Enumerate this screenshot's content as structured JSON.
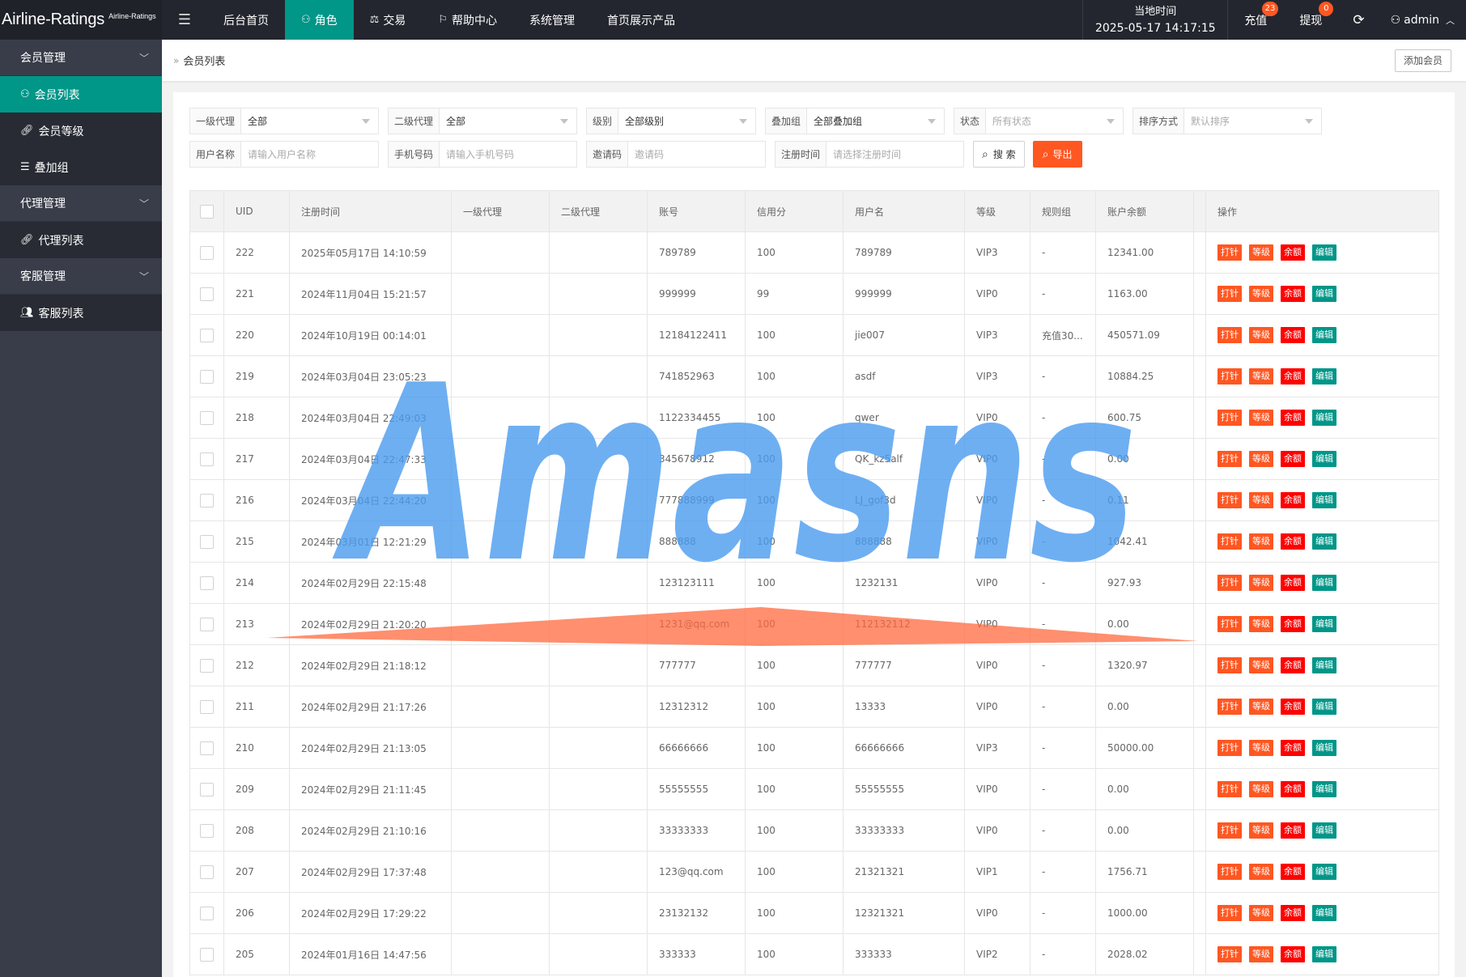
{
  "app": {
    "logo_main": "Airline-Ratings",
    "logo_sub": "Airline-Ratings"
  },
  "nav": [
    {
      "label": "后台首页",
      "icon": ""
    },
    {
      "label": "角色",
      "icon": "user-icon"
    },
    {
      "label": "交易",
      "icon": "scale-icon"
    },
    {
      "label": "帮助中心",
      "icon": "flag-icon"
    },
    {
      "label": "系统管理",
      "icon": ""
    },
    {
      "label": "首页展示产品",
      "icon": ""
    }
  ],
  "topright": {
    "time_label": "当地时间",
    "time_value": "2025-05-17 14:17:15",
    "recharge_label": "充值",
    "recharge_badge": "23",
    "withdraw_label": "提现",
    "withdraw_badge": "0",
    "user_label": "admin"
  },
  "sidebar": [
    {
      "type": "group",
      "label": "会员管理"
    },
    {
      "type": "item",
      "label": "会员列表",
      "icon": "user-icon",
      "active": true
    },
    {
      "type": "item",
      "label": "会员等级",
      "icon": "link-icon"
    },
    {
      "type": "item",
      "label": "叠加组",
      "icon": "list-icon"
    },
    {
      "type": "group",
      "label": "代理管理"
    },
    {
      "type": "item",
      "label": "代理列表",
      "icon": "link-icon"
    },
    {
      "type": "group",
      "label": "客服管理"
    },
    {
      "type": "item",
      "label": "客服列表",
      "icon": "users-icon"
    }
  ],
  "breadcrumb": {
    "current": "会员列表"
  },
  "add_button": "添加会员",
  "filters": {
    "row1": [
      {
        "label": "一级代理",
        "value": "全部",
        "placeholder": false
      },
      {
        "label": "二级代理",
        "value": "全部",
        "placeholder": false
      },
      {
        "label": "级别",
        "value": "全部级别",
        "placeholder": false
      },
      {
        "label": "叠加组",
        "value": "全部叠加组",
        "placeholder": false
      },
      {
        "label": "状态",
        "value": "所有状态",
        "placeholder": true
      },
      {
        "label": "排序方式",
        "value": "默认排序",
        "placeholder": true
      }
    ],
    "row2": [
      {
        "label": "用户名称",
        "value": "请输入用户名称"
      },
      {
        "label": "手机号码",
        "value": "请输入手机号码"
      },
      {
        "label": "邀请码",
        "value": "邀请码"
      },
      {
        "label": "注册时间",
        "value": "请选择注册时间"
      }
    ],
    "search_label": "搜 索",
    "export_label": "导出"
  },
  "table": {
    "headers": [
      "UID",
      "注册时间",
      "一级代理",
      "二级代理",
      "账号",
      "信用分",
      "用户名",
      "等级",
      "规则组",
      "账户余额",
      "",
      "操作"
    ],
    "actions": [
      "打针",
      "等级",
      "余额",
      "编辑"
    ],
    "rows": [
      [
        "222",
        "2025年05月17日 14:10:59",
        "",
        "",
        "789789",
        "100",
        "789789",
        "VIP3",
        "-",
        "12341.00"
      ],
      [
        "221",
        "2024年11月04日 15:21:57",
        "",
        "",
        "999999",
        "99",
        "999999",
        "VIP0",
        "-",
        "1163.00"
      ],
      [
        "220",
        "2024年10月19日 00:14:01",
        "",
        "",
        "12184122411",
        "100",
        "jie007",
        "VIP3",
        "充值30...",
        "450571.09"
      ],
      [
        "219",
        "2024年03月04日 23:05:23",
        "",
        "",
        "741852963",
        "100",
        "asdf",
        "VIP3",
        "-",
        "10884.25"
      ],
      [
        "218",
        "2024年03月04日 22:49:03",
        "",
        "",
        "1122334455",
        "100",
        "qwer",
        "VIP0",
        "-",
        "600.75"
      ],
      [
        "217",
        "2024年03月04日 22:47:33",
        "",
        "",
        "345678912",
        "100",
        "QK_kz5alf",
        "VIP0",
        "-",
        "0.00"
      ],
      [
        "216",
        "2024年03月04日 22:44:20",
        "",
        "",
        "777888999",
        "100",
        "LJ_gof3d",
        "VIP0",
        "-",
        "0.11"
      ],
      [
        "215",
        "2024年03月01日 12:21:29",
        "",
        "",
        "888888",
        "100",
        "888888",
        "VIP0",
        "-",
        "1042.41"
      ],
      [
        "214",
        "2024年02月29日 22:15:48",
        "",
        "",
        "123123111",
        "100",
        "1232131",
        "VIP0",
        "-",
        "927.93"
      ],
      [
        "213",
        "2024年02月29日 21:20:20",
        "",
        "",
        "1231@qq.com",
        "100",
        "112132112",
        "VIP0",
        "-",
        "0.00"
      ],
      [
        "212",
        "2024年02月29日 21:18:12",
        "",
        "",
        "777777",
        "100",
        "777777",
        "VIP0",
        "-",
        "1320.97"
      ],
      [
        "211",
        "2024年02月29日 21:17:26",
        "",
        "",
        "12312312",
        "100",
        "13333",
        "VIP0",
        "-",
        "0.00"
      ],
      [
        "210",
        "2024年02月29日 21:13:05",
        "",
        "",
        "66666666",
        "100",
        "66666666",
        "VIP3",
        "-",
        "50000.00"
      ],
      [
        "209",
        "2024年02月29日 21:11:45",
        "",
        "",
        "55555555",
        "100",
        "55555555",
        "VIP0",
        "-",
        "0.00"
      ],
      [
        "208",
        "2024年02月29日 21:10:16",
        "",
        "",
        "33333333",
        "100",
        "33333333",
        "VIP0",
        "-",
        "0.00"
      ],
      [
        "207",
        "2024年02月29日 17:37:48",
        "",
        "",
        "123@qq.com",
        "100",
        "21321321",
        "VIP1",
        "-",
        "1756.71"
      ],
      [
        "206",
        "2024年02月29日 17:29:22",
        "",
        "",
        "23132132",
        "100",
        "12321321",
        "VIP0",
        "-",
        "1000.00"
      ],
      [
        "205",
        "2024年01月16日 14:47:56",
        "",
        "",
        "333333",
        "100",
        "333333",
        "VIP2",
        "-",
        "2028.02"
      ]
    ]
  },
  "watermark": {
    "text": "Amasns",
    "color": "#4a9cf0",
    "accent": "#ff6a3d"
  },
  "colors": {
    "topbar": "#23262e",
    "sidebar": "#393d49",
    "accent": "#009688",
    "danger": "#ff5722"
  }
}
